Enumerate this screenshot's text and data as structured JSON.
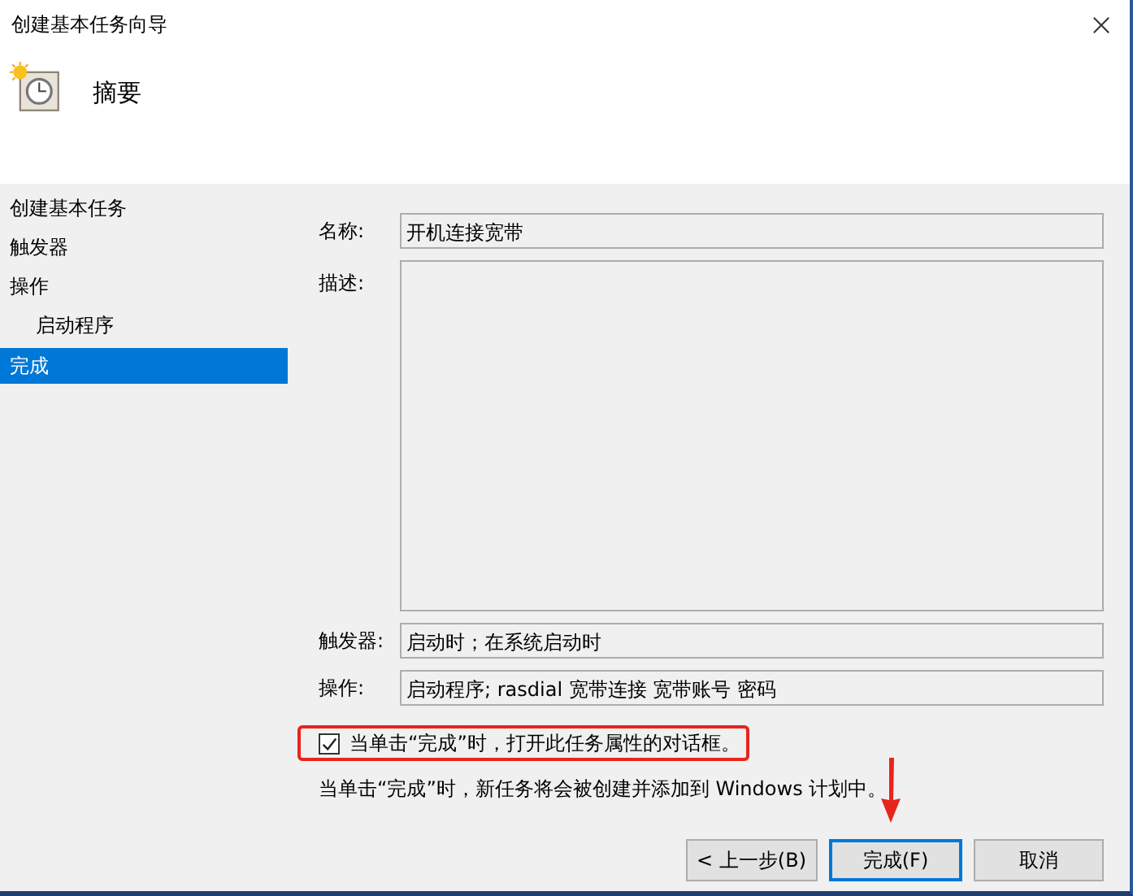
{
  "window": {
    "title": "创建基本任务向导"
  },
  "header": {
    "title": "摘要"
  },
  "steps": [
    {
      "label": "创建基本任务",
      "selected": false
    },
    {
      "label": "触发器",
      "selected": false
    },
    {
      "label": "操作",
      "selected": false,
      "children": [
        {
          "label": "启动程序",
          "selected": false
        }
      ]
    },
    {
      "label": "完成",
      "selected": true
    }
  ],
  "fields": [
    {
      "label": "名称:",
      "value": "开机连接宽带",
      "kind": "line"
    },
    {
      "label": "描述:",
      "kind": "area"
    },
    {
      "label": "触发器:",
      "value": "启动时；在系统启动时",
      "kind": "line"
    },
    {
      "label": "操作:",
      "value": "启动程序; rasdial 宽带连接 宽带账号  密码",
      "kind": "line"
    }
  ],
  "open_properties": {
    "label": "当单击“完成”时，打开此任务属性的对话框。",
    "checked": true
  },
  "note": "当单击“完成”时，新任务将会被创建并添加到 Windows 计划中。",
  "buttons": [
    {
      "label": "< 上一步(B)",
      "default": false
    },
    {
      "label": "完成(F)",
      "default": true
    },
    {
      "label": "取消",
      "default": false
    }
  ]
}
